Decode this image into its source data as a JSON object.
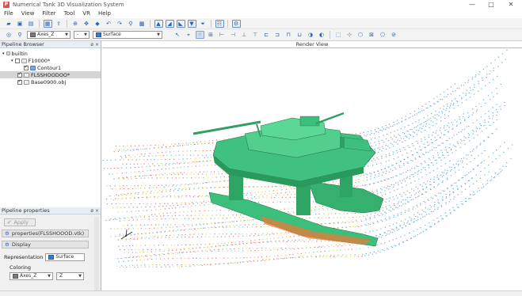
{
  "window": {
    "title": "Numerical Tank 3D Visualization System",
    "app_icon": "P",
    "controls": [
      "—",
      "□",
      "✕"
    ]
  },
  "menu": [
    "File",
    "View",
    "Filter",
    "Tool",
    "VR",
    "Help"
  ],
  "toolbar2": {
    "axis_combo": "Axes_Z",
    "rep_combo": "Surface",
    "small_combo": "-"
  },
  "pipeline_browser": {
    "title": "Pipeline Browser",
    "buttons": "ø ×",
    "items": [
      {
        "label": "builtin",
        "indent": 0
      },
      {
        "label": "F10000*",
        "indent": 1
      },
      {
        "label": "Contour1",
        "indent": 2
      },
      {
        "label": "FLSSHOODOO*",
        "indent": 1
      },
      {
        "label": "Base0900.obj",
        "indent": 1
      }
    ]
  },
  "pipeline_properties": {
    "title": "Pipeline properties",
    "buttons": "ø ×",
    "apply_label": "Apply",
    "properties_label": "properties(FLSSHOOOD.vtk)",
    "display_label": "Display",
    "representation_label": "Representation",
    "representation_value": "Surface",
    "coloring_label": "Coloring",
    "coloring_value": "Axes_Z",
    "coloring_value2": "Z"
  },
  "render_view": {
    "title": "Render View"
  },
  "colors": {
    "hull": "#3cbf7a",
    "hull_dark": "#2a9a5c",
    "stream_blue": "#3a8fe0",
    "stream_yellow": "#f1c232",
    "stream_red": "#e04848"
  }
}
